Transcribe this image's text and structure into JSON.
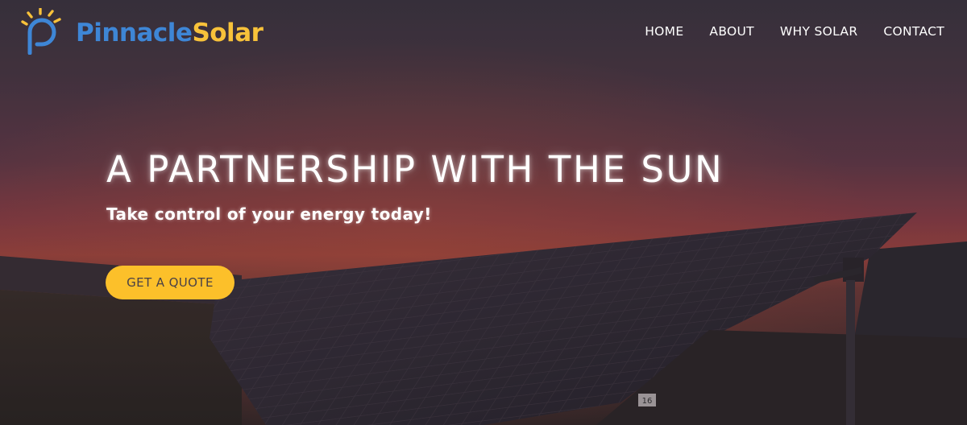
{
  "brand": {
    "name_part1": "Pinnacle",
    "name_part2": "Solar",
    "logo_icon": "sun-p-icon",
    "colors": {
      "blue": "#3e86d6",
      "yellow": "#f8c23a"
    }
  },
  "nav": {
    "items": [
      {
        "label": "HOME"
      },
      {
        "label": "ABOUT"
      },
      {
        "label": "WHY SOLAR"
      },
      {
        "label": "CONTACT"
      }
    ]
  },
  "hero": {
    "headline": "A PARTNERSHIP WITH THE SUN",
    "subheadline": "Take control of your energy today!",
    "cta_label": "GET A QUOTE",
    "cta_color": "#fcc02a",
    "background": "solar-panel-field-at-sunset",
    "panel_tag": "16"
  }
}
